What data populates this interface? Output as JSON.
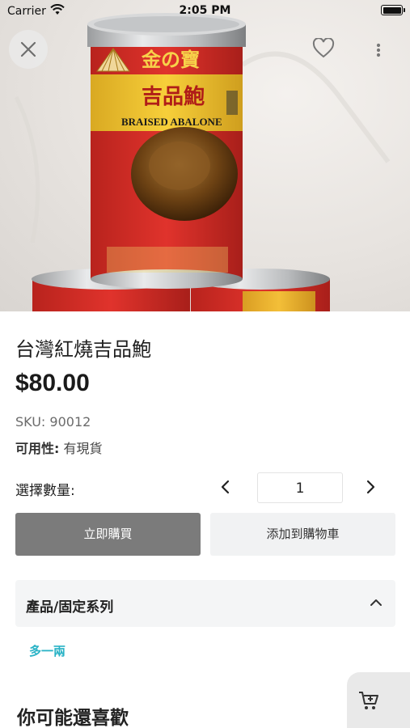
{
  "status_bar": {
    "carrier": "Carrier",
    "time": "2:05 PM"
  },
  "product_image": {
    "can_brand_top": "金の寶",
    "can_name_cn": "吉品鮑",
    "can_name_en": "BRAISED ABALONE"
  },
  "product": {
    "title": "台灣紅燒吉品鮑",
    "price": "$80.00",
    "sku": "SKU: 90012",
    "availability_label": "可用性:",
    "availability_value": " 有現貨"
  },
  "quantity": {
    "label": "選擇數量:",
    "value": "1"
  },
  "actions": {
    "buy_now": "立即購買",
    "add_to_cart": "添加到購物車"
  },
  "accordion": {
    "label": "產品/固定系列"
  },
  "series_link": "多一兩",
  "recommendations": {
    "heading": "你可能還喜歡"
  },
  "icons": {
    "close": "close-icon",
    "favorite": "heart-icon",
    "more": "more-vertical-icon",
    "prev": "chevron-left-icon",
    "next": "chevron-right-icon",
    "collapse": "chevron-up-icon",
    "cart": "cart-add-icon"
  },
  "colors": {
    "buy_bg": "#7b7b7b",
    "cart_bg": "#f1f2f3",
    "link": "#2ab3c6",
    "can_red": "#d8302a",
    "can_yellow": "#f2c22f"
  }
}
